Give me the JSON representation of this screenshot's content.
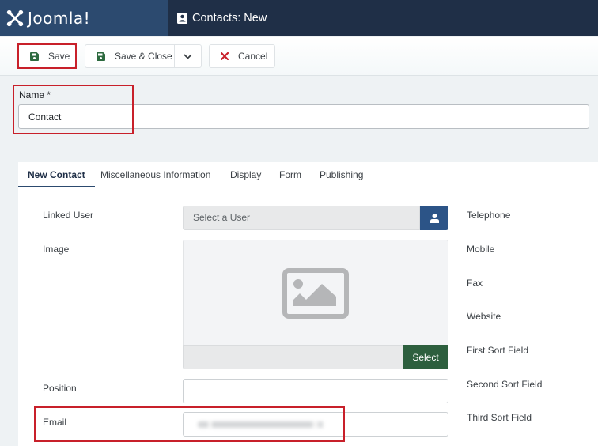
{
  "header": {
    "brand": "Joomla!",
    "page_title": "Contacts: New",
    "page_icon": "address-card-icon"
  },
  "toolbar": {
    "save_label": "Save",
    "save_close_label": "Save & Close",
    "cancel_label": "Cancel"
  },
  "name_field": {
    "label": "Name *",
    "value": "Contact"
  },
  "tabs": [
    {
      "label": "New Contact",
      "active": true
    },
    {
      "label": "Miscellaneous Information",
      "active": false
    },
    {
      "label": "Display",
      "active": false
    },
    {
      "label": "Form",
      "active": false
    },
    {
      "label": "Publishing",
      "active": false
    }
  ],
  "form": {
    "linked_user_label": "Linked User",
    "linked_user_placeholder": "Select a User",
    "image_label": "Image",
    "image_select_label": "Select",
    "position_label": "Position",
    "position_value": "",
    "email_label": "Email",
    "email_value": "(redacted)"
  },
  "right_column": {
    "labels": [
      "Telephone",
      "Mobile",
      "Fax",
      "Website",
      "First Sort Field",
      "Second Sort Field",
      "Third Sort Field"
    ]
  },
  "colors": {
    "header_bg": "#1f2f47",
    "brand_bg": "#2c4a6f",
    "highlight": "#c8202a",
    "select_green": "#2d5f3e",
    "user_button_blue": "#2c5487",
    "save_icon_green": "#2d6a3f",
    "cancel_icon_red": "#c8202a"
  }
}
